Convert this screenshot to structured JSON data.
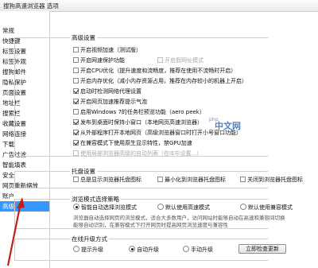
{
  "window": {
    "title": "搜狗高速浏览器 选项"
  },
  "sidebar": {
    "items": [
      {
        "label": "常规"
      },
      {
        "label": "快捷键"
      },
      {
        "label": "标签设置"
      },
      {
        "label": "标签外观"
      },
      {
        "label": "搜狗邮件"
      },
      {
        "label": "隐私保护"
      },
      {
        "label": "页面设置"
      },
      {
        "label": "地址栏"
      },
      {
        "label": "搜索栏"
      },
      {
        "label": "收藏设置"
      },
      {
        "label": "网络连接"
      },
      {
        "label": "下载"
      },
      {
        "label": "广告过滤"
      },
      {
        "label": "智能填表"
      },
      {
        "label": "安全"
      },
      {
        "label": "网页重新缩放"
      },
      {
        "label": "账户"
      },
      {
        "label": "高级"
      }
    ],
    "selected_index": 17
  },
  "advanced": {
    "title": "高级设置",
    "options": [
      {
        "label": "开启视频加速（测试版）",
        "checked": false
      },
      {
        "label": "开启网速保护功能",
        "checked": false
      },
      {
        "label": "开启假网址模式",
        "checked": false,
        "disabled": true
      },
      {
        "label": "开启CPU优化（提升速度和流畅度，推荐在使用不流畅时开启）",
        "checked": false
      },
      {
        "label": "开启内存优化（减小内存资源占用，推荐在内存较小的机器上开启）",
        "checked": false
      },
      {
        "label": "启动时检测网络代理设置",
        "checked": true
      },
      {
        "label": "开启网页加速推荐提示气泡",
        "checked": true
      },
      {
        "label": "启用Windows 7的任务栏预览功能（aero peek）",
        "checked": false
      },
      {
        "label": "发布到桌面时保持小窗口（本地网页高速浏览器）",
        "checked": true
      },
      {
        "label": "从外部程序打开本地网页（高级浏览器窗口时打开小号窗口功能）",
        "checked": true
      },
      {
        "label": "在兼容模式下使用原生显示特性，禁GPU加速",
        "checked": true
      },
      {
        "label": "使用局部浏览器高级的自动列表（在IE中设置...）",
        "checked": false,
        "disabled": true
      }
    ]
  },
  "tray": {
    "title": "托盘设置",
    "options": [
      {
        "label": "总是显示浏览器托盘图标",
        "checked": false
      },
      {
        "label": "最小化到浏览器托盘图标",
        "checked": false
      },
      {
        "label": "关闭到浏览器托盘图标",
        "checked": false
      }
    ]
  },
  "mode": {
    "title": "浏览模式选择策略",
    "options": [
      {
        "label": "智能自动选择浏览模式",
        "selected": true
      },
      {
        "label": "默认使用高速模式",
        "selected": false
      },
      {
        "label": "默认使用兼容模式",
        "selected": false
      }
    ],
    "note_line1": "浏览器自动选择网页的浏览模式，适合大多数用户，访问网站时能够自动在高速和兼容间切换",
    "note_line2": "能够自动识别，在兼容模式下打开网页时提高网页浏览速度与兼容性"
  },
  "update": {
    "title": "在线升级方式",
    "options": [
      {
        "label": "提示升级",
        "selected": false
      },
      {
        "label": "自动升级",
        "selected": true
      },
      {
        "label": "手动升级",
        "selected": false
      }
    ],
    "button_label": "立即检查更新"
  },
  "watermark": {
    "text": "中文网",
    "sub": "php"
  },
  "colors": {
    "selection": "#3399ff",
    "arrow": "#c0201a",
    "watermark": "#2b6cc4"
  }
}
